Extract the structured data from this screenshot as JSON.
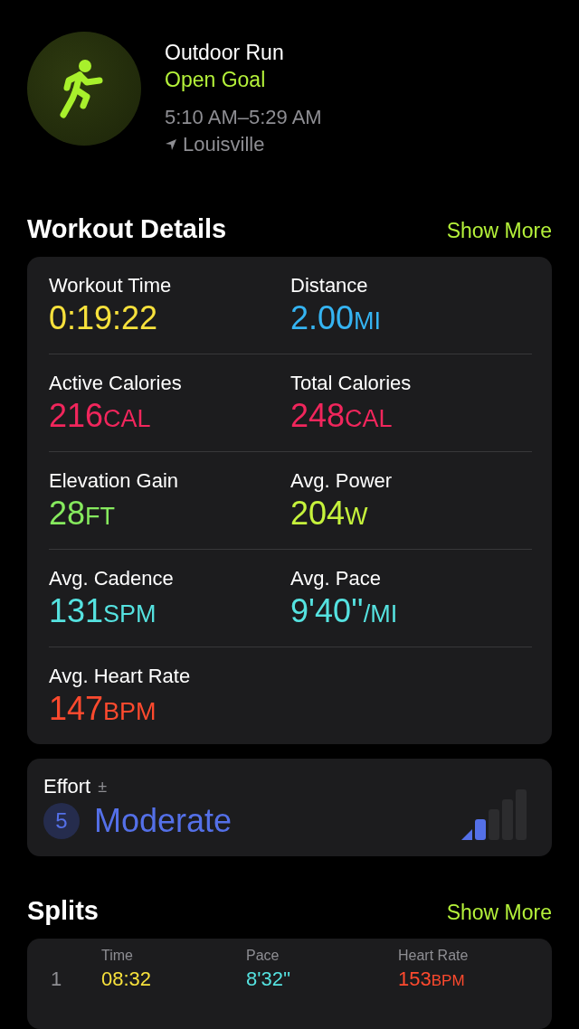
{
  "workout": {
    "title": "Outdoor Run",
    "goal": "Open Goal",
    "time_range": "5:10 AM–5:29 AM",
    "location": "Louisville"
  },
  "details": {
    "heading": "Workout Details",
    "action": "Show More",
    "metrics": [
      {
        "label": "Workout Time",
        "value": "0:19:22",
        "color": "#f7e13c"
      },
      {
        "label": "Distance",
        "value": "2.00",
        "unit": "MI",
        "color": "#35b4f2"
      },
      {
        "label": "Active Calories",
        "value": "216",
        "unit": "CAL",
        "color": "#f1265c"
      },
      {
        "label": "Total Calories",
        "value": "248",
        "unit": "CAL",
        "color": "#f1265c"
      },
      {
        "label": "Elevation Gain",
        "value": "28",
        "unit": "FT",
        "color": "#86ea5e"
      },
      {
        "label": "Avg. Power",
        "value": "204",
        "unit": "W",
        "color": "#c6f33c"
      },
      {
        "label": "Avg. Cadence",
        "value": "131",
        "unit": "SPM",
        "color": "#55e2e0"
      },
      {
        "label": "Avg. Pace",
        "value": "9'40''",
        "unit": "/MI",
        "color": "#55e2e0"
      },
      {
        "label": "Avg. Heart Rate",
        "value": "147",
        "unit": "BPM",
        "color": "#ff4a2e"
      }
    ]
  },
  "effort": {
    "label": "Effort",
    "adjust": "±",
    "score": "5",
    "rating": "Moderate",
    "bars": [
      {
        "on": true
      },
      {
        "on": true
      },
      {
        "on": false
      },
      {
        "on": false
      },
      {
        "on": false
      }
    ]
  },
  "splits": {
    "heading": "Splits",
    "action": "Show More",
    "columns": [
      "Time",
      "Pace",
      "Heart Rate"
    ],
    "rows": [
      {
        "index": "1",
        "time": "08:32",
        "pace": "8'32''",
        "heart_rate": "153",
        "unit": "BPM"
      }
    ]
  }
}
